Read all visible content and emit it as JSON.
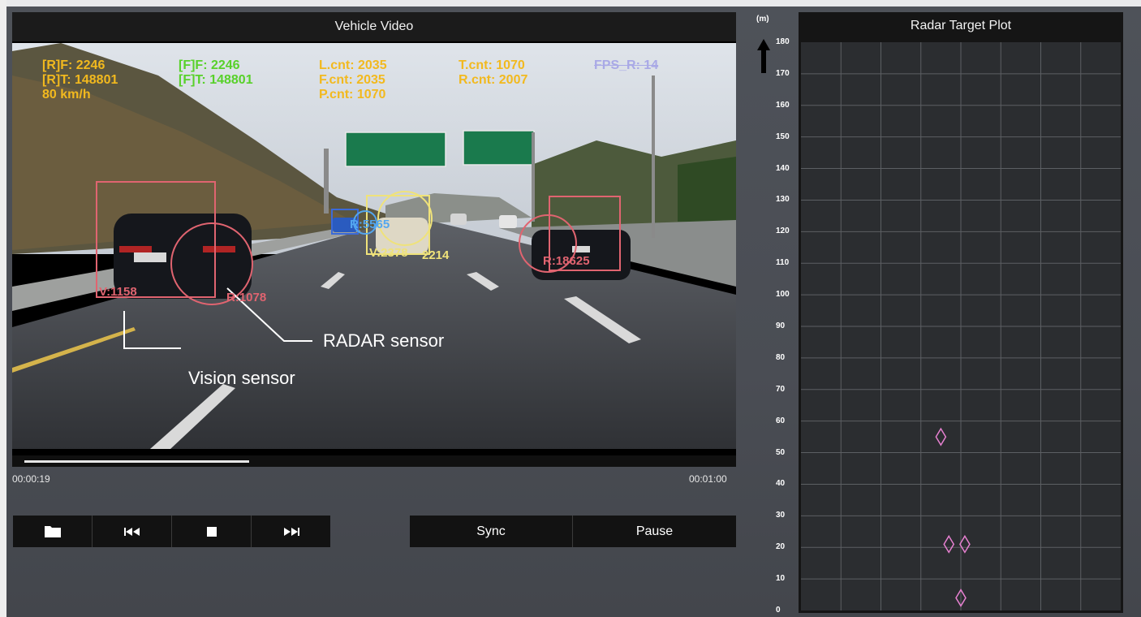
{
  "video": {
    "title": "Vehicle Video",
    "overlay": {
      "rf": "[R]F: 2246",
      "rt": "[R]T: 148801",
      "speed": "80 km/h",
      "ff": "[F]F: 2246",
      "ft": "[F]T: 148801",
      "lcnt": "L.cnt: 2035",
      "fcnt": "F.cnt: 2035",
      "pcnt": "P.cnt: 1070",
      "tcnt": "T.cnt: 1070",
      "rcnt": "R.cnt: 2007",
      "fps": "FPS_R: 14"
    },
    "detections": {
      "left_vision": "V:1158",
      "left_radar": "R:1078",
      "center_radar": "R:5565",
      "center_vision": "V:2378",
      "center_extra": "2214",
      "right_radar": "R:18625"
    },
    "annotations": {
      "radar": "RADAR sensor",
      "vision": "Vision sensor"
    },
    "current_time": "00:00:19",
    "total_time": "00:01:00",
    "progress": 0.31
  },
  "controls": {
    "open_icon": "folder-icon",
    "prev_icon": "skip-back-icon",
    "stop_icon": "stop-icon",
    "next_icon": "skip-forward-icon",
    "sync_label": "Sync",
    "pause_label": "Pause"
  },
  "radar": {
    "title": "Radar Target Plot",
    "unit": "(m)",
    "y_ticks": [
      "180",
      "170",
      "160",
      "150",
      "140",
      "130",
      "120",
      "110",
      "100",
      "90",
      "80",
      "70",
      "60",
      "50",
      "40",
      "30",
      "20",
      "10",
      "0"
    ],
    "targets": [
      {
        "x": 0,
        "y": 55
      },
      {
        "x": 0.2,
        "y": 21
      },
      {
        "x": 0.6,
        "y": 21
      },
      {
        "x": 0.5,
        "y": 4
      }
    ]
  },
  "colors": {
    "overlay_yellow": "#f2b91e",
    "overlay_green": "#58d12a",
    "vision_box": "#e06470",
    "radar_circle": "#e06470",
    "center_box": "#efe27a",
    "target_marker": "#e680d0"
  }
}
